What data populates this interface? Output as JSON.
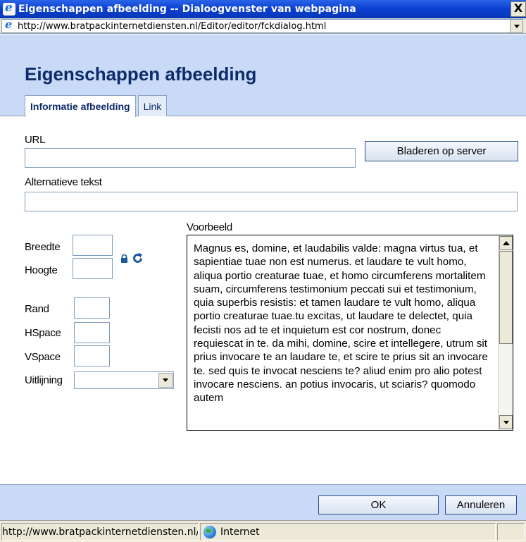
{
  "window": {
    "title": "Eigenschappen afbeelding -- Dialoogvenster van webpagina",
    "close_label": "X"
  },
  "address": {
    "url": "http://www.bratpackinternetdiensten.nl/Editor/editor/fckdialog.html"
  },
  "dialog": {
    "title": "Eigenschappen afbeelding",
    "tabs": [
      {
        "label": "Informatie afbeelding",
        "active": true
      },
      {
        "label": "Link",
        "active": false
      }
    ]
  },
  "form": {
    "url_label": "URL",
    "url_value": "",
    "browse_button": "Bladeren op server",
    "alt_label": "Alternatieve tekst",
    "alt_value": "",
    "width_label": "Breedte",
    "height_label": "Hoogte",
    "border_label": "Rand",
    "hspace_label": "HSpace",
    "vspace_label": "VSpace",
    "align_label": "Uitlijning",
    "align_value": "",
    "preview_label": "Voorbeeld",
    "preview_text": "Magnus es, domine, et laudabilis valde: magna virtus tua, et sapientiae tuae non est numerus. et laudare te vult homo, aliqua portio creaturae tuae, et homo circumferens mortalitem suam, circumferens testimonium peccati sui et testimonium, quia superbis resistis: et tamen laudare te vult homo, aliqua portio creaturae tuae.tu excitas, ut laudare te delectet, quia fecisti nos ad te et inquietum est cor nostrum, donec requiescat in te. da mihi, domine, scire et intellegere, utrum sit prius invocare te an laudare te, et scire te prius sit an invocare te. sed quis te invocat nesciens te? aliud enim pro alio potest invocare nesciens. an potius invocaris, ut sciaris? quomodo autem"
  },
  "buttons": {
    "ok": "OK",
    "cancel": "Annuleren"
  },
  "status": {
    "url": "http://www.bratpackinternetdiensten.nl/",
    "zone": "Internet"
  },
  "icons": {
    "app": "ie-icon",
    "lock": "lock-icon",
    "refresh": "refresh-icon",
    "zone": "globe-icon"
  },
  "colors": {
    "titlebar": "#0a3fd0",
    "header_bg": "#c9daf6",
    "dialog_title": "#0c2b6b"
  }
}
